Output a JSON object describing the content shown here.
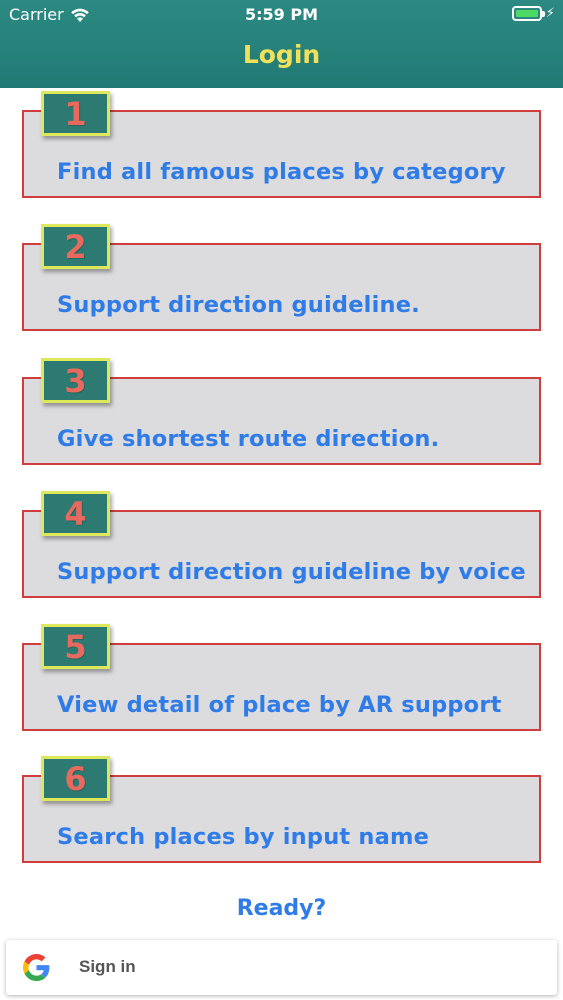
{
  "status_bar": {
    "carrier": "Carrier",
    "time": "5:59 PM",
    "battery_level": 0.85,
    "battery_color": "#4cd964"
  },
  "header": {
    "title": "Login",
    "background": "#217a73",
    "title_color": "#f1e05a"
  },
  "features": [
    {
      "number": "1",
      "text": "Find all famous places by category"
    },
    {
      "number": "2",
      "text": "Support direction guideline."
    },
    {
      "number": "3",
      "text": "Give shortest route direction."
    },
    {
      "number": "4",
      "text": "Support direction guideline by voice"
    },
    {
      "number": "5",
      "text": "View detail of place by AR support"
    },
    {
      "number": "6",
      "text": "Search places by input name"
    }
  ],
  "ready_label": "Ready?",
  "signin": {
    "icon": "google-icon",
    "label": "Sign in"
  },
  "colors": {
    "card_background": "#dcdbdd",
    "card_border": "#cf3d3d",
    "badge_background": "#2c7a72",
    "badge_border": "#dde85a",
    "badge_number": "#e8695d",
    "feature_text": "#2f7ce8"
  }
}
